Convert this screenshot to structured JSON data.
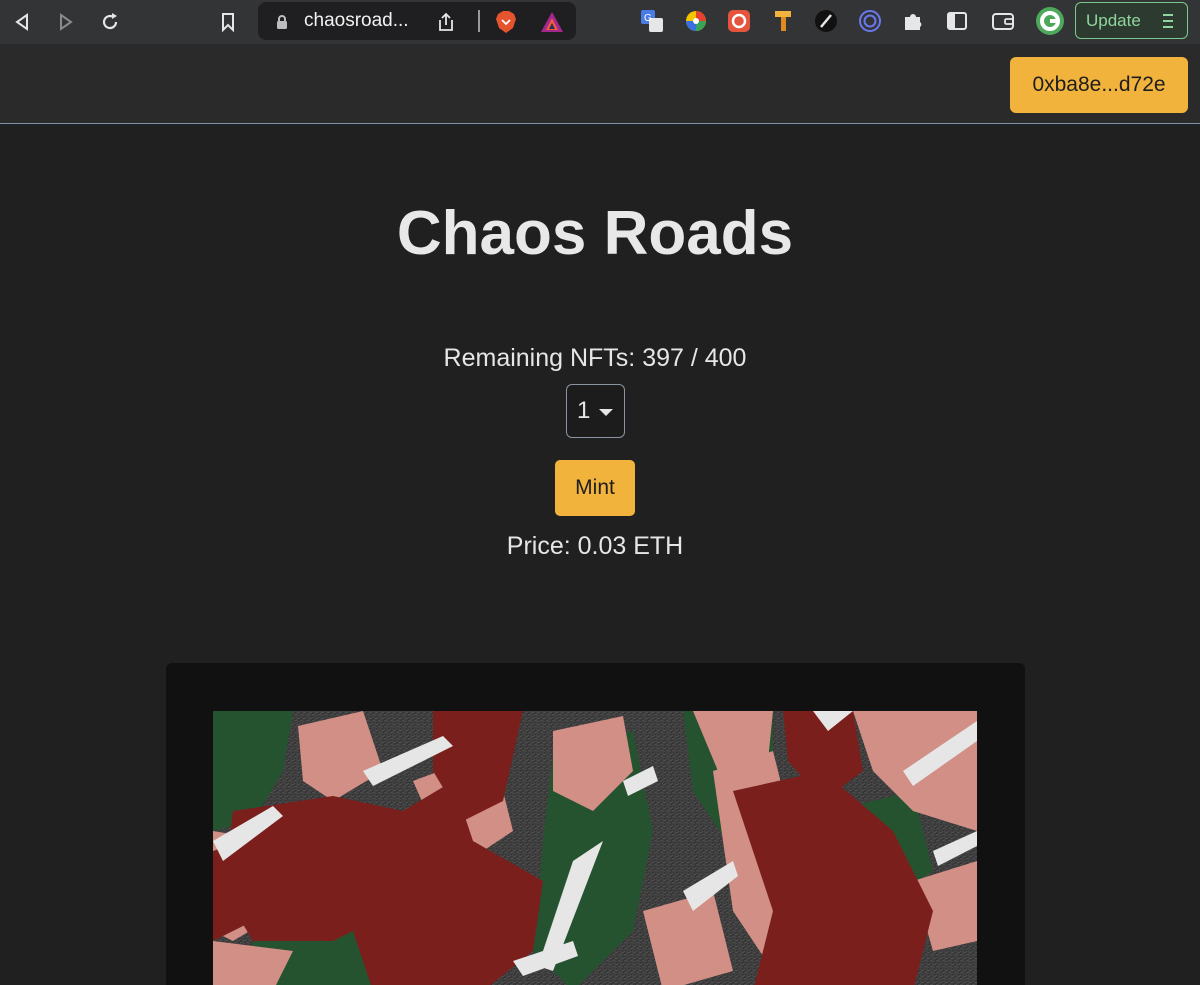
{
  "browser": {
    "url": "chaosroad...",
    "update_label": "Update",
    "update_menu_glyph": "☰",
    "icons": {
      "back": "back-arrow-icon",
      "forward": "forward-arrow-icon",
      "reload": "reload-icon",
      "bookmark": "bookmark-icon",
      "lock": "lock-icon",
      "share": "share-icon",
      "brave": "brave-lion-icon",
      "rewards": "brave-rewards-icon",
      "extensions": [
        "translate-icon",
        "color-wheel-icon",
        "record-icon",
        "pin-icon",
        "slash-icon",
        "circle-target-icon",
        "puzzle-extensions-icon",
        "sidebar-icon",
        "wallet-icon",
        "profile-avatar-icon"
      ]
    }
  },
  "app": {
    "wallet_address": "0xba8e...d72e",
    "title": "Chaos Roads",
    "remaining_label": "Remaining NFTs: 397 / 400",
    "quantity_value": "1",
    "mint_label": "Mint",
    "price_label": "Price: 0.03 ETH",
    "accent_color": "#f2b33d",
    "art_colors": [
      "#26532f",
      "#7b1f1d",
      "#d28f86",
      "#e6e6e6",
      "#3c3c3c"
    ]
  }
}
